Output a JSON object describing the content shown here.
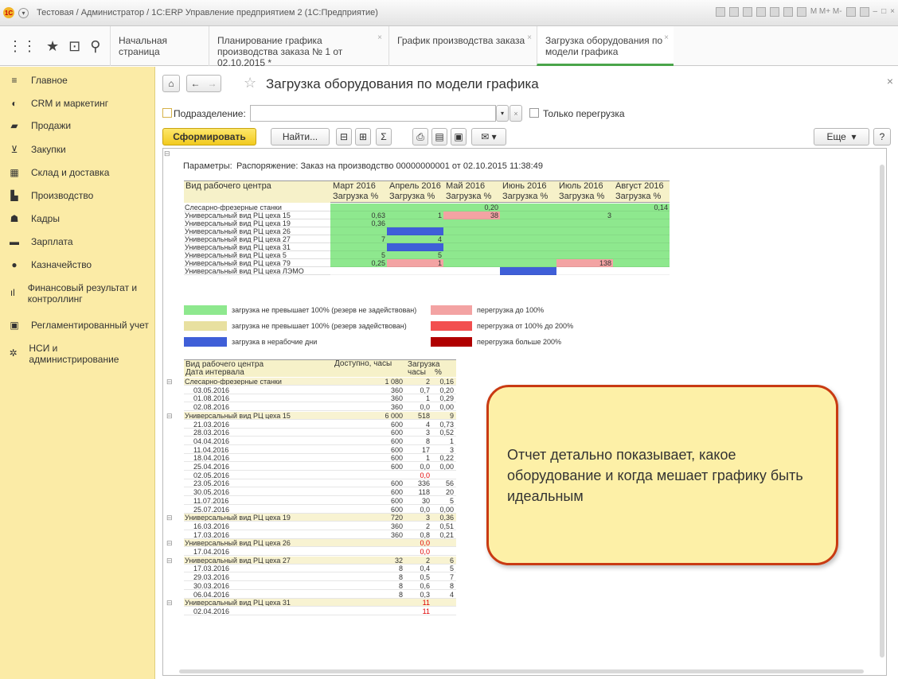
{
  "window": {
    "title": "Тестовая / Администратор / 1С:ERP Управление предприятием 2  (1С:Предприятие)",
    "memory_buttons": "M  M+  M-"
  },
  "tabs": [
    {
      "label": "Начальная страница"
    },
    {
      "label": "Планирование графика производства заказа № 1 от 02.10.2015 *"
    },
    {
      "label": "График производства заказа"
    },
    {
      "label": "Загрузка оборудования по модели графика"
    }
  ],
  "sidebar": {
    "items": [
      {
        "label": "Главное",
        "icon": "menu-icon"
      },
      {
        "label": "CRM и маркетинг",
        "icon": "crm-icon"
      },
      {
        "label": "Продажи",
        "icon": "bag-icon"
      },
      {
        "label": "Закупки",
        "icon": "cart-icon"
      },
      {
        "label": "Склад и доставка",
        "icon": "warehouse-icon"
      },
      {
        "label": "Производство",
        "icon": "factory-icon"
      },
      {
        "label": "Кадры",
        "icon": "person-icon"
      },
      {
        "label": "Зарплата",
        "icon": "wallet-icon"
      },
      {
        "label": "Казначейство",
        "icon": "coin-icon"
      },
      {
        "label": "Финансовый результат и контроллинг",
        "icon": "chart-icon"
      },
      {
        "label": "Регламентированный учет",
        "icon": "printer-icon"
      },
      {
        "label": "НСИ и администрирование",
        "icon": "gear-icon"
      }
    ]
  },
  "page": {
    "title": "Загрузка оборудования по модели графика",
    "department_label": "Подразделение:",
    "department_value": "",
    "overload_only_label": "Только перегрузка",
    "generate_button": "Сформировать",
    "find_button": "Найти...",
    "more_button": "Еще",
    "help_button": "?"
  },
  "report": {
    "params_label": "Параметры:",
    "params_value": "Распоряжение: Заказ на производство 00000000001 от 02.10.2015 11:38:49",
    "matrix": {
      "corner": "Вид рабочего центра",
      "months": [
        "Март 2016",
        "Апрель 2016",
        "Май 2016",
        "Июнь 2016",
        "Июль 2016",
        "Август 2016"
      ],
      "sub": "Загрузка %",
      "rows": [
        {
          "name": "Слесарно-фрезерные станки",
          "cells": [
            {
              "v": "",
              "c": "g"
            },
            {
              "v": "",
              "c": "g"
            },
            {
              "v": "0,20",
              "c": "g"
            },
            {
              "v": "",
              "c": "g"
            },
            {
              "v": "",
              "c": "g"
            },
            {
              "v": "0,14",
              "c": "g"
            }
          ]
        },
        {
          "name": "Универсальный вид РЦ цеха 15",
          "cells": [
            {
              "v": "0,63",
              "c": "g"
            },
            {
              "v": "1",
              "c": "g"
            },
            {
              "v": "38",
              "c": "p"
            },
            {
              "v": "",
              "c": "g"
            },
            {
              "v": "3",
              "c": "g"
            },
            {
              "v": "",
              "c": "g"
            }
          ]
        },
        {
          "name": "Универсальный вид РЦ цеха 19",
          "cells": [
            {
              "v": "0,36",
              "c": "g"
            },
            {
              "v": "",
              "c": "g"
            },
            {
              "v": "",
              "c": "g"
            },
            {
              "v": "",
              "c": "g"
            },
            {
              "v": "",
              "c": "g"
            },
            {
              "v": "",
              "c": "g"
            }
          ]
        },
        {
          "name": "Универсальный вид РЦ цеха 26",
          "cells": [
            {
              "v": "",
              "c": "g"
            },
            {
              "v": "",
              "c": "b"
            },
            {
              "v": "",
              "c": "g"
            },
            {
              "v": "",
              "c": "g"
            },
            {
              "v": "",
              "c": "g"
            },
            {
              "v": "",
              "c": "g"
            }
          ]
        },
        {
          "name": "Универсальный вид РЦ цеха 27",
          "cells": [
            {
              "v": "7",
              "c": "g"
            },
            {
              "v": "4",
              "c": "g"
            },
            {
              "v": "",
              "c": "g"
            },
            {
              "v": "",
              "c": "g"
            },
            {
              "v": "",
              "c": "g"
            },
            {
              "v": "",
              "c": "g"
            }
          ]
        },
        {
          "name": "Универсальный вид РЦ цеха 31",
          "cells": [
            {
              "v": "",
              "c": "g"
            },
            {
              "v": "",
              "c": "b"
            },
            {
              "v": "",
              "c": "g"
            },
            {
              "v": "",
              "c": "g"
            },
            {
              "v": "",
              "c": "g"
            },
            {
              "v": "",
              "c": "g"
            }
          ]
        },
        {
          "name": "Универсальный вид РЦ цеха 5",
          "cells": [
            {
              "v": "5",
              "c": "g"
            },
            {
              "v": "5",
              "c": "g"
            },
            {
              "v": "",
              "c": "g"
            },
            {
              "v": "",
              "c": "g"
            },
            {
              "v": "",
              "c": "g"
            },
            {
              "v": "",
              "c": "g"
            }
          ]
        },
        {
          "name": "Универсальный вид РЦ цеха 79",
          "cells": [
            {
              "v": "0,25",
              "c": "g"
            },
            {
              "v": "1",
              "c": "p"
            },
            {
              "v": "",
              "c": "g"
            },
            {
              "v": "",
              "c": "g"
            },
            {
              "v": "138",
              "c": "p"
            },
            {
              "v": "",
              "c": "g"
            }
          ]
        },
        {
          "name": "Универсальный вид РЦ цеха ЛЭМО",
          "cells": [
            {
              "v": "",
              "c": "w"
            },
            {
              "v": "",
              "c": "w"
            },
            {
              "v": "",
              "c": "w"
            },
            {
              "v": "",
              "c": "b"
            },
            {
              "v": "",
              "c": "w"
            },
            {
              "v": "",
              "c": "w"
            }
          ]
        }
      ]
    },
    "legend": [
      {
        "label": "загрузка не превышает 100% (резерв не задействован)",
        "color": "#8ee88e"
      },
      {
        "label": "загрузка не превышает 100% (резерв задействован)",
        "color": "#e8e0a0"
      },
      {
        "label": "загрузка в нерабочие дни",
        "color": "#3f5fd8"
      },
      {
        "label": "перегрузка до 100%",
        "color": "#f3a3a3"
      },
      {
        "label": "перегрузка от 100% до 200%",
        "color": "#f24f4f"
      },
      {
        "label": "перегрузка больше 200%",
        "color": "#b00000"
      }
    ],
    "detail": {
      "headers": {
        "col1": "Вид рабочего центра",
        "col1b": "Дата интервала",
        "col2": "Доступно, часы",
        "col3": "Загрузка",
        "col3a": "часы",
        "col3b": "%"
      },
      "rows": [
        {
          "g": true,
          "name": "Слесарно-фрезерные станки",
          "avail": "1 080",
          "hrs": "2",
          "pct": "0,16"
        },
        {
          "g": false,
          "name": "03.05.2016",
          "avail": "360",
          "hrs": "0,7",
          "pct": "0,20"
        },
        {
          "g": false,
          "name": "01.08.2016",
          "avail": "360",
          "hrs": "1",
          "pct": "0,29"
        },
        {
          "g": false,
          "name": "02.08.2016",
          "avail": "360",
          "hrs": "0,0",
          "pct": "0,00"
        },
        {
          "g": true,
          "name": "Универсальный вид РЦ цеха 15",
          "avail": "6 000",
          "hrs": "518",
          "pct": "9"
        },
        {
          "g": false,
          "name": "21.03.2016",
          "avail": "600",
          "hrs": "4",
          "pct": "0,73"
        },
        {
          "g": false,
          "name": "28.03.2016",
          "avail": "600",
          "hrs": "3",
          "pct": "0,52"
        },
        {
          "g": false,
          "name": "04.04.2016",
          "avail": "600",
          "hrs": "8",
          "pct": "1"
        },
        {
          "g": false,
          "name": "11.04.2016",
          "avail": "600",
          "hrs": "17",
          "pct": "3"
        },
        {
          "g": false,
          "name": "18.04.2016",
          "avail": "600",
          "hrs": "1",
          "pct": "0,22"
        },
        {
          "g": false,
          "name": "25.04.2016",
          "avail": "600",
          "hrs": "0,0",
          "pct": "0,00"
        },
        {
          "g": false,
          "name": "02.05.2016",
          "avail": "",
          "hrs": "0,0",
          "pct": "",
          "red": true
        },
        {
          "g": false,
          "name": "23.05.2016",
          "avail": "600",
          "hrs": "336",
          "pct": "56"
        },
        {
          "g": false,
          "name": "30.05.2016",
          "avail": "600",
          "hrs": "118",
          "pct": "20"
        },
        {
          "g": false,
          "name": "11.07.2016",
          "avail": "600",
          "hrs": "30",
          "pct": "5"
        },
        {
          "g": false,
          "name": "25.07.2016",
          "avail": "600",
          "hrs": "0,0",
          "pct": "0,00"
        },
        {
          "g": true,
          "name": "Универсальный вид РЦ цеха 19",
          "avail": "720",
          "hrs": "3",
          "pct": "0,36"
        },
        {
          "g": false,
          "name": "16.03.2016",
          "avail": "360",
          "hrs": "2",
          "pct": "0,51"
        },
        {
          "g": false,
          "name": "17.03.2016",
          "avail": "360",
          "hrs": "0,8",
          "pct": "0,21"
        },
        {
          "g": true,
          "name": "Универсальный вид РЦ цеха 26",
          "avail": "",
          "hrs": "0,0",
          "pct": "",
          "red": true
        },
        {
          "g": false,
          "name": "17.04.2016",
          "avail": "",
          "hrs": "0,0",
          "pct": "",
          "red": true
        },
        {
          "g": true,
          "name": "Универсальный вид РЦ цеха 27",
          "avail": "32",
          "hrs": "2",
          "pct": "6"
        },
        {
          "g": false,
          "name": "17.03.2016",
          "avail": "8",
          "hrs": "0,4",
          "pct": "5"
        },
        {
          "g": false,
          "name": "29.03.2016",
          "avail": "8",
          "hrs": "0,5",
          "pct": "7"
        },
        {
          "g": false,
          "name": "30.03.2016",
          "avail": "8",
          "hrs": "0,6",
          "pct": "8"
        },
        {
          "g": false,
          "name": "06.04.2016",
          "avail": "8",
          "hrs": "0,3",
          "pct": "4"
        },
        {
          "g": true,
          "name": "Универсальный вид РЦ цеха 31",
          "avail": "",
          "hrs": "11",
          "pct": "",
          "red": true
        },
        {
          "g": false,
          "name": "02.04.2016",
          "avail": "",
          "hrs": "11",
          "pct": "",
          "red": true
        }
      ]
    }
  },
  "callout": {
    "text": "Отчет детально показывает, какое оборудование и когда мешает графику быть идеальным"
  }
}
